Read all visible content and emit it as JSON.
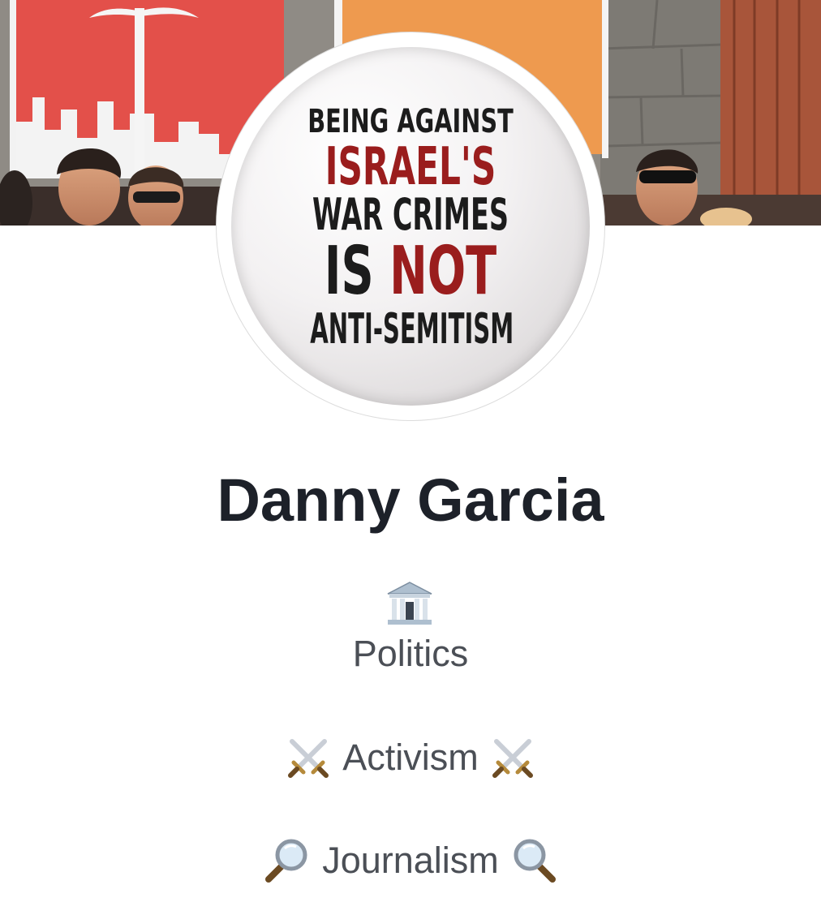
{
  "profile": {
    "name": "Danny Garcia",
    "picture_text": {
      "line1": "BEING AGAINST",
      "line2": "ISRAEL'S",
      "line3": "WAR CRIMES",
      "line4_a": "IS",
      "line4_b": "NOT",
      "line5": "ANTI-SEMITISM"
    },
    "bio": {
      "category": "Politics",
      "category_icon": "classical-building-icon",
      "line2": "Activism",
      "line2_icon": "crossed-swords-icon",
      "line3": "Journalism",
      "line3_icon_left": "magnifying-glass-left-icon",
      "line3_icon_right": "magnifying-glass-right-icon"
    }
  },
  "colors": {
    "name_text": "#1d2129",
    "bio_text": "#4b4f56",
    "badge_red": "#9a1d1d",
    "badge_black": "#1c1c1c",
    "background": "#ffffff"
  }
}
